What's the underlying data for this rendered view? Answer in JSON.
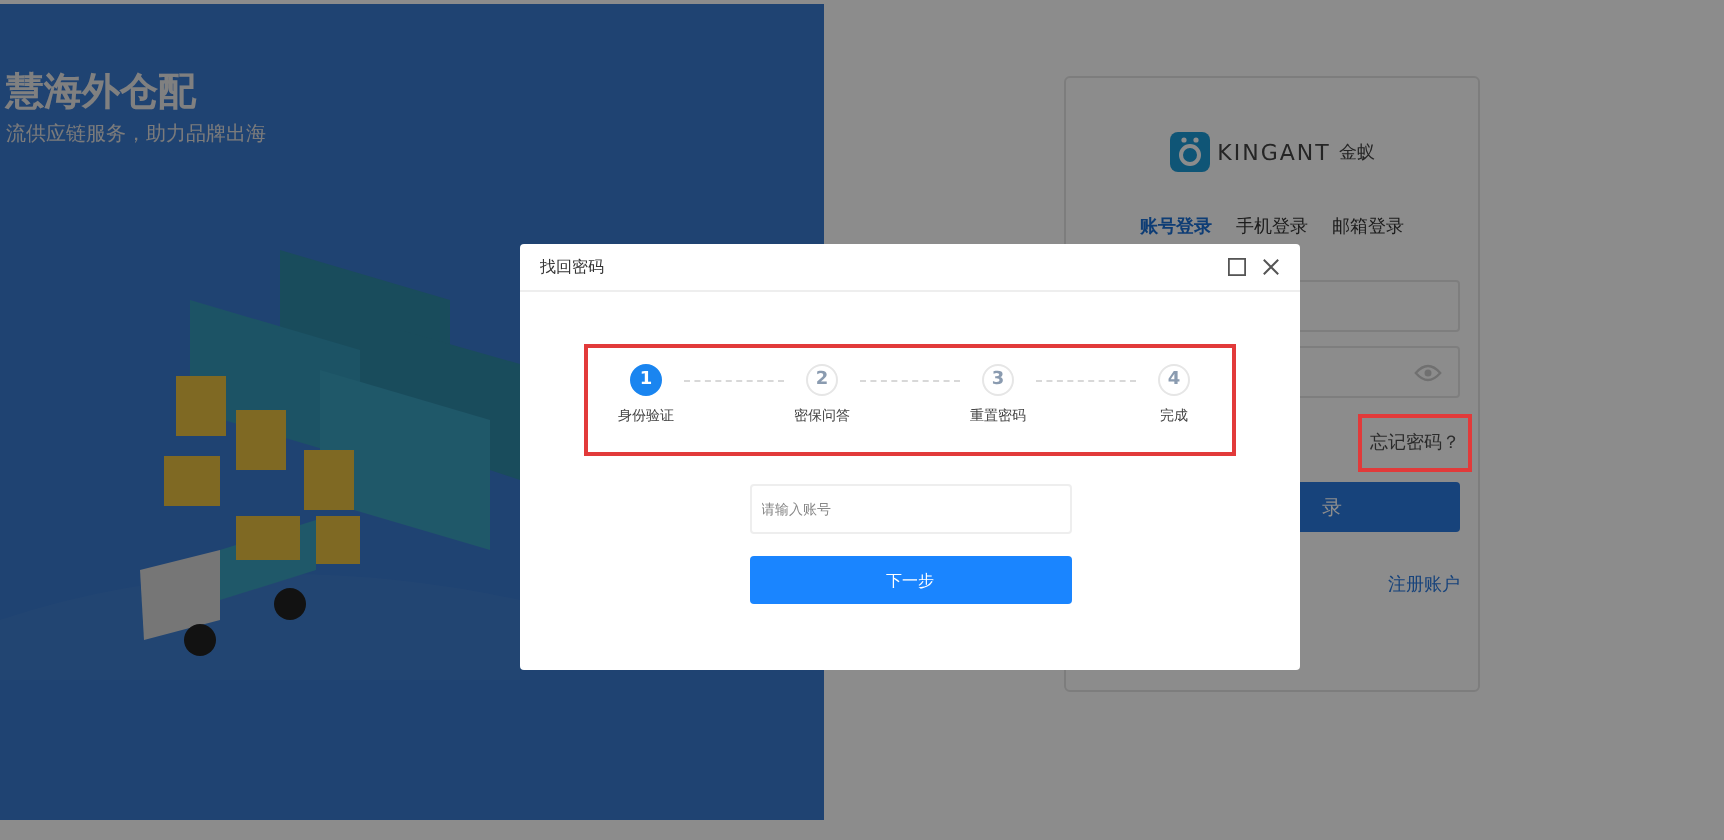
{
  "hero": {
    "title": "慧海外仓配",
    "subtitle": "流供应链服务，助力品牌出海"
  },
  "login": {
    "logo": {
      "brand": "KINGANT",
      "name": "金蚁"
    },
    "tabs": [
      {
        "label": "账号登录",
        "selected": true
      },
      {
        "label": "手机登录",
        "selected": false
      },
      {
        "label": "邮箱登录",
        "selected": false
      }
    ],
    "forgot_link": {
      "label": "忘记密码？",
      "highlighted": true
    },
    "login_button": "录",
    "register_link": "注册账户"
  },
  "dialog": {
    "title": "找回密码",
    "steps_highlighted": true,
    "steps": [
      {
        "number": "1",
        "label": "身份验证",
        "selected": true
      },
      {
        "number": "2",
        "label": "密保问答",
        "selected": false
      },
      {
        "number": "3",
        "label": "重置密码",
        "selected": false
      },
      {
        "number": "4",
        "label": "完成",
        "selected": false
      }
    ],
    "account_field": {
      "placeholder": "请输入账号"
    },
    "next_button": "下一步"
  }
}
